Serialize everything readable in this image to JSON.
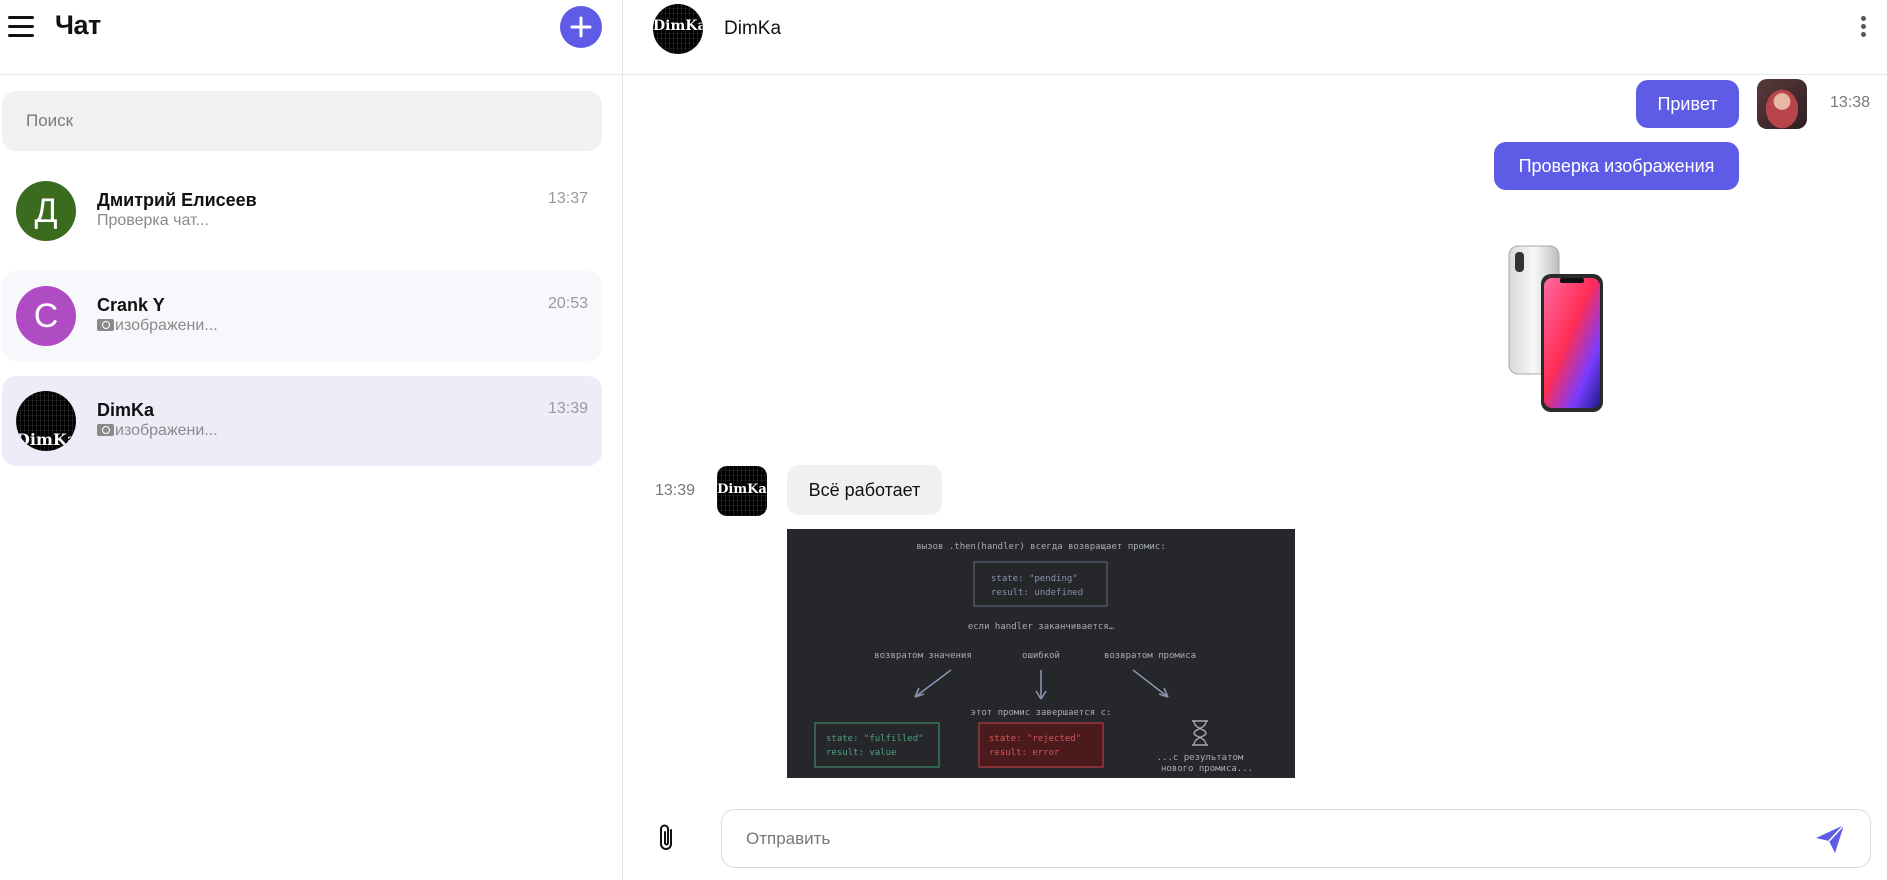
{
  "sidebar": {
    "title": "Чат",
    "search_placeholder": "Поиск",
    "chats": [
      {
        "name": "Дмитрий Елисеев",
        "preview": "Проверка чат...",
        "time": "13:37",
        "avatar_letter": "Д",
        "avatar_color": "#3a6b1f"
      },
      {
        "name": "Crank Y",
        "preview": "изображени...",
        "time": "20:53",
        "avatar_letter": "C",
        "avatar_color": "#b04cc3"
      },
      {
        "name": "DimKa",
        "preview": "изображени...",
        "time": "13:39",
        "avatar_logo": "DimKa"
      }
    ]
  },
  "chat": {
    "contact_name": "DimKa",
    "contact_logo": "DimKa",
    "messages": [
      {
        "direction": "out",
        "text": "Привет",
        "time": "13:38"
      },
      {
        "direction": "out",
        "text": "Проверка изображения"
      },
      {
        "direction": "out",
        "type": "image",
        "image": "iphone-x-photo"
      },
      {
        "direction": "in",
        "text": "Всё работает",
        "time": "13:39",
        "sender_logo": "DimKa"
      },
      {
        "direction": "in",
        "type": "image",
        "image": "promise-diagram"
      }
    ],
    "diagram": {
      "title": "вызов .then(handler) всегда возвращает промис:",
      "pending_state": "state: \"pending\"",
      "pending_result": "result: undefined",
      "middle": "если handler заканчивается…",
      "branch_value": "возвратом значения",
      "branch_error": "ошибкой",
      "branch_promise": "возвратом промиса",
      "settles": "этот промис завершается с:",
      "fulfilled_state": "state: \"fulfilled\"",
      "fulfilled_result": "result: value",
      "rejected_state": "state: \"rejected\"",
      "rejected_result": "result: error",
      "new_promise_1": "...с результатом",
      "new_promise_2": "нового промиса..."
    },
    "composer": {
      "placeholder": "Отправить"
    }
  },
  "colors": {
    "accent": "#5e5ce6",
    "active_row": "#ededfa",
    "bubble_in": "#f0f0f0"
  }
}
